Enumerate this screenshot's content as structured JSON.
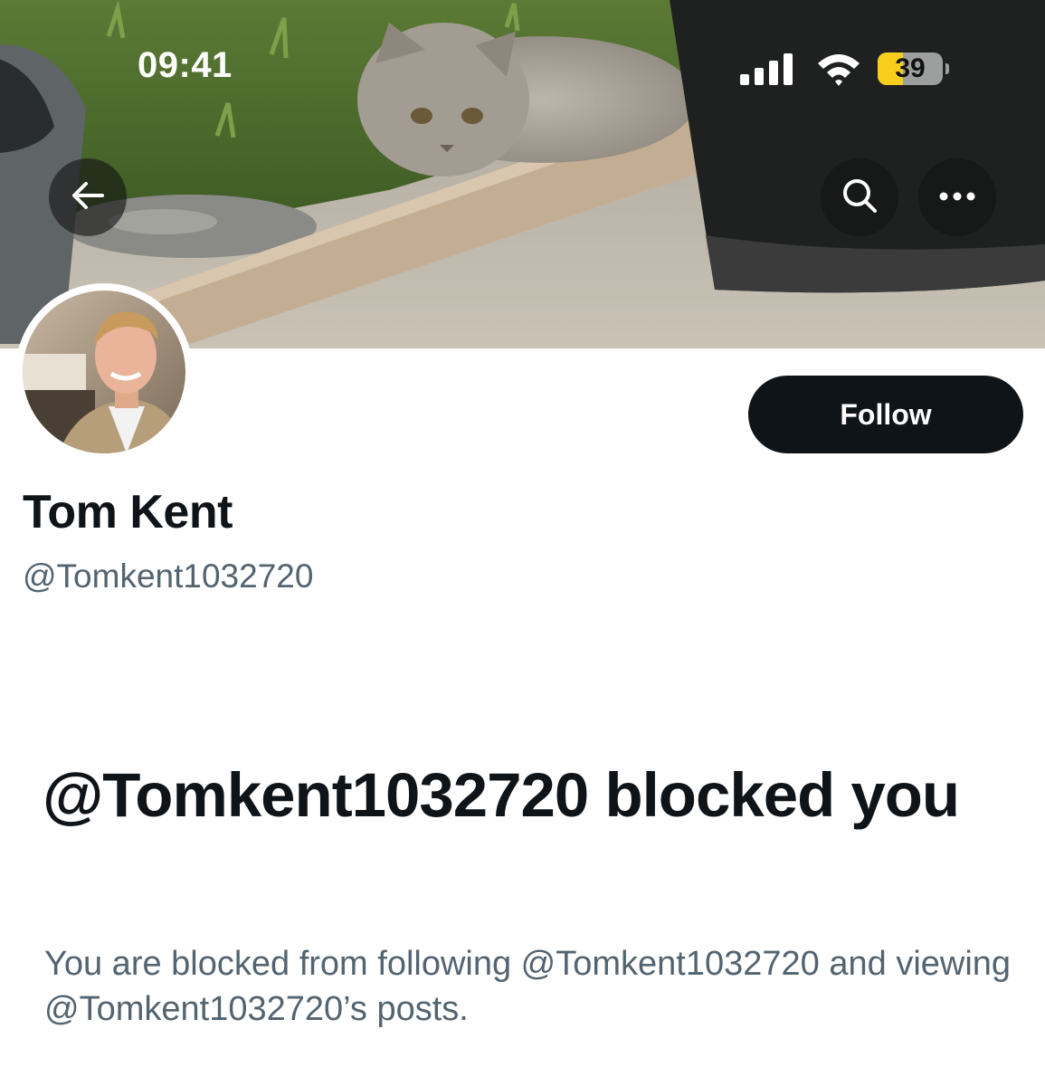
{
  "status_bar": {
    "time": "09:41",
    "battery_level": "39",
    "battery_fraction": 0.39,
    "signal_icon": "cellular-signal-icon",
    "wifi_icon": "wifi-icon"
  },
  "header": {
    "back_icon": "arrow-left-icon",
    "search_icon": "search-icon",
    "more_icon": "more-horizontal-icon"
  },
  "profile": {
    "follow_label": "Follow",
    "display_name": "Tom Kent",
    "handle": "@Tomkent1032720"
  },
  "blocked_notice": {
    "title": "@Tomkent1032720 blocked you",
    "description": "You are blocked from following @Tomkent1032720 and viewing @Tomkent1032720’s posts."
  },
  "colors": {
    "text_primary": "#0f1419",
    "text_secondary": "#536471",
    "follow_button_bg": "#0f1419",
    "battery_fill": "#f7ce1b"
  }
}
